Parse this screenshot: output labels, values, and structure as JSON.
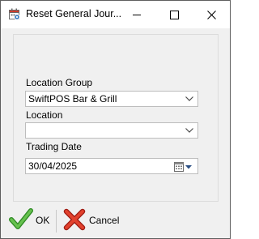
{
  "window": {
    "title": "Reset General Jour...",
    "icon": "calendar-settings-icon"
  },
  "titlebar_buttons": {
    "minimize_icon": "minimize-icon",
    "maximize_icon": "maximize-icon",
    "close_icon": "close-icon"
  },
  "form": {
    "location_group": {
      "label": "Location Group",
      "value": "SwiftPOS Bar & Grill"
    },
    "location": {
      "label": "Location",
      "value": ""
    },
    "trading_date": {
      "label": "Trading Date",
      "value": "30/04/2025"
    }
  },
  "actions": {
    "ok_label": "OK",
    "ok_icon": "green-checkmark-icon",
    "cancel_label": "Cancel",
    "cancel_icon": "red-x-icon"
  },
  "colors": {
    "ok_green": "#4caf3c",
    "cancel_red": "#d9301f",
    "border": "#bdbdbd",
    "background": "#f0f0f0"
  }
}
